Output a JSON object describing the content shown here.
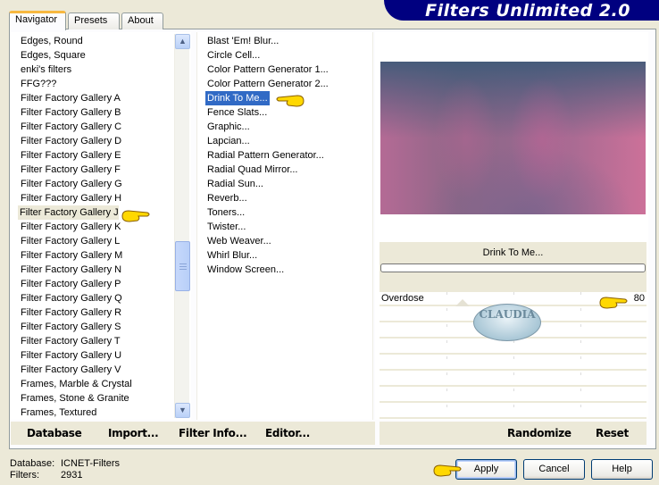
{
  "app": {
    "title": "Filters Unlimited 2.0",
    "brand_color": "#000080"
  },
  "tabs": [
    {
      "label": "Navigator",
      "active": true
    },
    {
      "label": "Presets",
      "active": false
    },
    {
      "label": "About",
      "active": false
    }
  ],
  "categories": {
    "selected": "Filter Factory Gallery J",
    "items": [
      "Edges, Round",
      "Edges, Square",
      "enki's filters",
      "FFG???",
      "Filter Factory Gallery A",
      "Filter Factory Gallery B",
      "Filter Factory Gallery C",
      "Filter Factory Gallery D",
      "Filter Factory Gallery E",
      "Filter Factory Gallery F",
      "Filter Factory Gallery G",
      "Filter Factory Gallery H",
      "Filter Factory Gallery J",
      "Filter Factory Gallery K",
      "Filter Factory Gallery L",
      "Filter Factory Gallery M",
      "Filter Factory Gallery N",
      "Filter Factory Gallery P",
      "Filter Factory Gallery Q",
      "Filter Factory Gallery R",
      "Filter Factory Gallery S",
      "Filter Factory Gallery T",
      "Filter Factory Gallery U",
      "Filter Factory Gallery V",
      "Frames, Marble & Crystal",
      "Frames, Stone & Granite",
      "Frames, Textured"
    ],
    "scroll_up_icon": "▲",
    "scroll_down_icon": "▼"
  },
  "filters": {
    "selected": "Drink To Me...",
    "items": [
      "Blast 'Em! Blur...",
      "Circle Cell...",
      "Color Pattern Generator 1...",
      "Color Pattern Generator 2...",
      "Drink To Me...",
      "Fence Slats...",
      "Graphic...",
      "Lapcian...",
      "Radial Pattern Generator...",
      "Radial Quad Mirror...",
      "Radial Sun...",
      "Reverb...",
      "Toners...",
      "Twister...",
      "Web Weaver...",
      "Whirl Blur...",
      "Window Screen..."
    ],
    "selection_color": "#316ac5"
  },
  "preview": {
    "filter_name": "Drink To Me...",
    "progress": 0
  },
  "parameters": [
    {
      "label": "Overdose",
      "value": "80"
    },
    {
      "label": "",
      "value": ""
    },
    {
      "label": "",
      "value": ""
    },
    {
      "label": "",
      "value": ""
    },
    {
      "label": "",
      "value": ""
    },
    {
      "label": "",
      "value": ""
    },
    {
      "label": "",
      "value": ""
    },
    {
      "label": "",
      "value": ""
    }
  ],
  "watermark": {
    "text": "CLAUDIA"
  },
  "toolbar": {
    "database": "Database",
    "import": "Import...",
    "filter_info": "Filter Info...",
    "editor": "Editor...",
    "randomize": "Randomize",
    "reset": "Reset"
  },
  "status": {
    "database_label": "Database:",
    "database_value": "ICNET-Filters",
    "filters_label": "Filters:",
    "filters_value": "2931"
  },
  "buttons": {
    "apply": "Apply",
    "cancel": "Cancel",
    "help": "Help"
  }
}
